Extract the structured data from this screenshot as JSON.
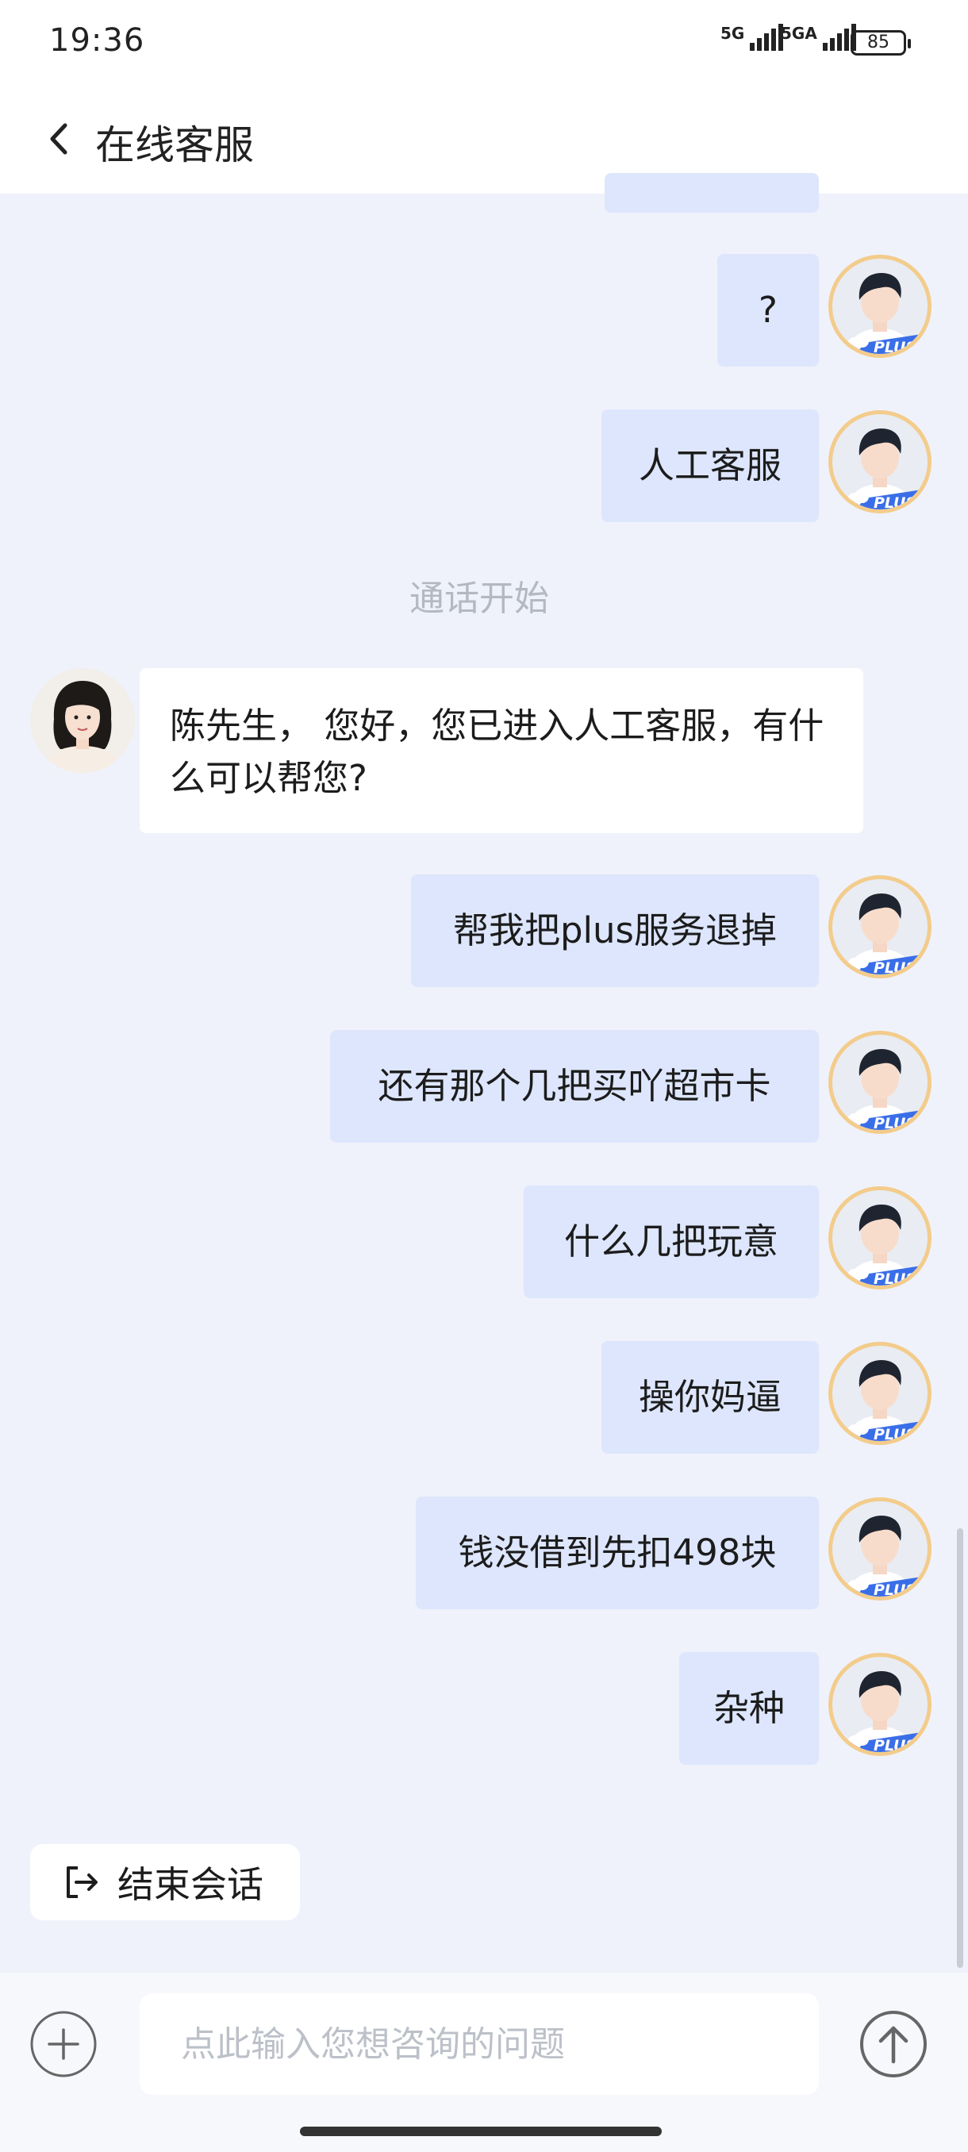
{
  "status_bar": {
    "time": "19:36",
    "signal_1": "5G",
    "signal_2": "5GA",
    "battery": "85"
  },
  "header": {
    "title": "在线客服"
  },
  "messages": [
    {
      "from": "user",
      "text": "?"
    },
    {
      "from": "user",
      "text": "人工客服"
    },
    {
      "from": "system",
      "text": "通话开始"
    },
    {
      "from": "agent",
      "text": "陈先生， 您好，您已进入人工客服，有什么可以帮您?"
    },
    {
      "from": "user",
      "text": "帮我把plus服务退掉"
    },
    {
      "from": "user",
      "text": "还有那个几把买吖超市卡"
    },
    {
      "from": "user",
      "text": "什么几把玩意"
    },
    {
      "from": "user",
      "text": "操你妈逼"
    },
    {
      "from": "user",
      "text": "钱没借到先扣498块"
    },
    {
      "from": "user",
      "text": "杂种"
    }
  ],
  "avatar_badge": "PLUS",
  "end_button": {
    "label": "结束会话"
  },
  "composer": {
    "placeholder": "点此输入您想咨询的问题"
  },
  "colors": {
    "page_bg": "#eff2fa",
    "user_bubble": "#dde6fc",
    "agent_bubble": "#ffffff",
    "plus_badge": "#3a6ee8",
    "avatar_ring": "#f3cc8c"
  }
}
